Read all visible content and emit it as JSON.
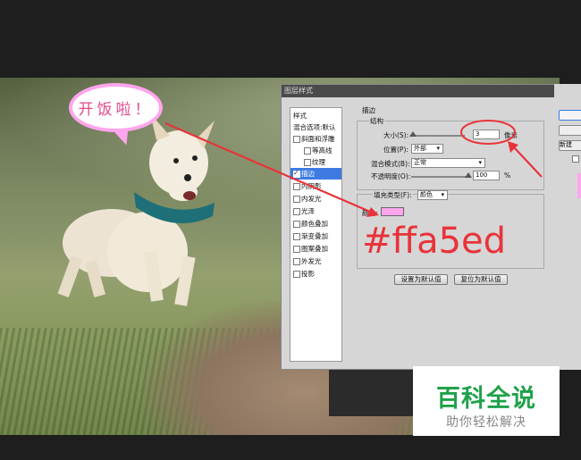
{
  "bubble": {
    "text": "开饭啦！"
  },
  "dialog": {
    "title": "图层样式",
    "left_panel": {
      "items": [
        {
          "label": "样式",
          "type": "header"
        },
        {
          "label": "混合选项:默认",
          "type": "header"
        },
        {
          "label": "斜面和浮雕",
          "type": "check",
          "checked": false
        },
        {
          "label": "等高线",
          "type": "subcheck",
          "checked": false
        },
        {
          "label": "纹理",
          "type": "subcheck",
          "checked": false
        },
        {
          "label": "描边",
          "type": "check",
          "checked": true,
          "selected": true
        },
        {
          "label": "内阴影",
          "type": "check",
          "checked": false
        },
        {
          "label": "内发光",
          "type": "check",
          "checked": false
        },
        {
          "label": "光泽",
          "type": "check",
          "checked": false
        },
        {
          "label": "颜色叠加",
          "type": "check",
          "checked": false
        },
        {
          "label": "渐变叠加",
          "type": "check",
          "checked": false
        },
        {
          "label": "图案叠加",
          "type": "check",
          "checked": false
        },
        {
          "label": "外发光",
          "type": "check",
          "checked": false
        },
        {
          "label": "投影",
          "type": "check",
          "checked": false
        }
      ]
    },
    "stroke": {
      "section_title": "描边",
      "structure_title": "结构",
      "size_label": "大小(S):",
      "size_value": "3",
      "size_unit": "像素",
      "size_slider_fraction": 0.03,
      "position_label": "位置(P):",
      "position_value": "外部",
      "blend_label": "混合模式(B):",
      "blend_value": "正常",
      "opacity_label": "不透明度(O):",
      "opacity_value": "100",
      "opacity_unit": "%",
      "opacity_slider_fraction": 1.0,
      "fill_type_label": "填充类型(F):",
      "fill_type_value": "颜色",
      "color_label": "颜色:",
      "color_value": "#ffa5ed",
      "hex_annotation": "#ffa5ed"
    },
    "buttons": {
      "set_default": "设置为默认值",
      "reset_default": "复位为默认值"
    },
    "right_buttons": {
      "new_style": "新建"
    }
  },
  "watermark": {
    "title": "百科全说",
    "subtitle": "助你轻松解决"
  },
  "colors": {
    "accent_pink": "#ffa5ed",
    "annotation_red": "#e8333a",
    "watermark_green": "#1fa24a",
    "selection_blue": "#3d7be2"
  },
  "icons": [
    "dropdown-arrow-icon",
    "slider-thumb-icon",
    "checkbox-icon",
    "annotation-arrow-icon"
  ]
}
